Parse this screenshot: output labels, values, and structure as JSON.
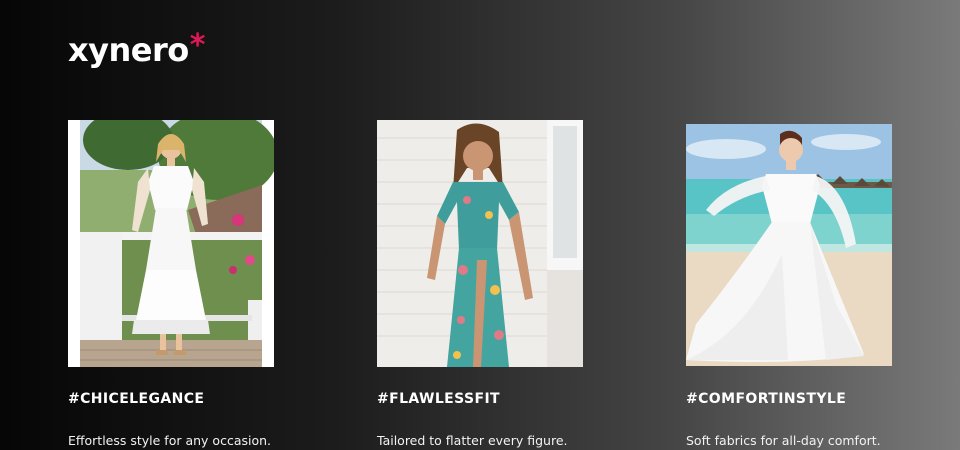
{
  "brand": {
    "name": "xynero",
    "mark": "*"
  },
  "cards": [
    {
      "hashtag": "#CHICELEGANCE",
      "description": "Effortless style for any occasion."
    },
    {
      "hashtag": "#FLAWLESSFIT",
      "description": "Tailored to flatter every figure."
    },
    {
      "hashtag": "#COMFORTINSTYLE",
      "description": "Soft fabrics for all-day comfort."
    }
  ],
  "colors": {
    "accent": "#e0185a",
    "text": "#ffffff",
    "background_start": "#060606",
    "background_end": "#7a7a7a"
  }
}
